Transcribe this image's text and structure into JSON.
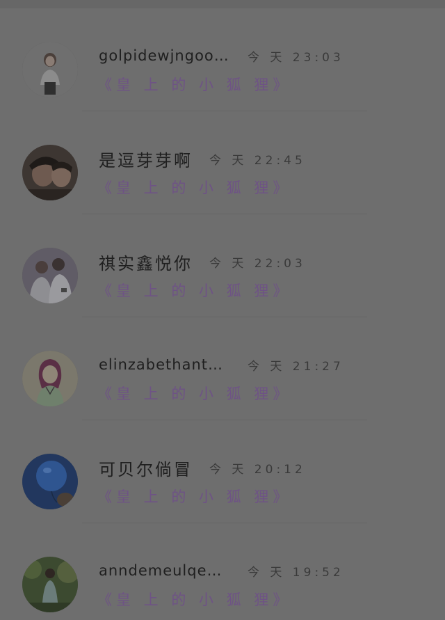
{
  "comments": [
    {
      "name": "golpidewjngoose",
      "time": "今 天 23:03",
      "source": "《皇 上 的 小 狐 狸》",
      "avatar_icon": "girl-photo-avatar-icon",
      "name_style": "latin"
    },
    {
      "name": "是逗芽芽啊",
      "time": "今 天 22:45",
      "source": "《皇 上 的 小 狐 狸》",
      "avatar_icon": "couple-photo-avatar-icon",
      "name_style": "cn"
    },
    {
      "name": "祺实鑫悦你",
      "time": "今 天 22:03",
      "source": "《皇 上 的 小 狐 狸》",
      "avatar_icon": "two-people-photo-avatar-icon",
      "name_style": "cn"
    },
    {
      "name": "elinzabethantdja…",
      "time": "今 天 21:27",
      "source": "《皇 上 的 小 狐 狸》",
      "avatar_icon": "cartoon-girl-avatar-icon",
      "name_style": "latin"
    },
    {
      "name": "可贝尔倘冒",
      "time": "今 天 20:12",
      "source": "《皇 上 的 小 狐 狸》",
      "avatar_icon": "blue-balloon-avatar-icon",
      "name_style": "cn"
    },
    {
      "name": "anndemeulqemeeg…",
      "time": "今 天 19:52",
      "source": "《皇 上 的 小 狐 狸》",
      "avatar_icon": "woman-garden-photo-avatar-icon",
      "name_style": "latin"
    }
  ]
}
